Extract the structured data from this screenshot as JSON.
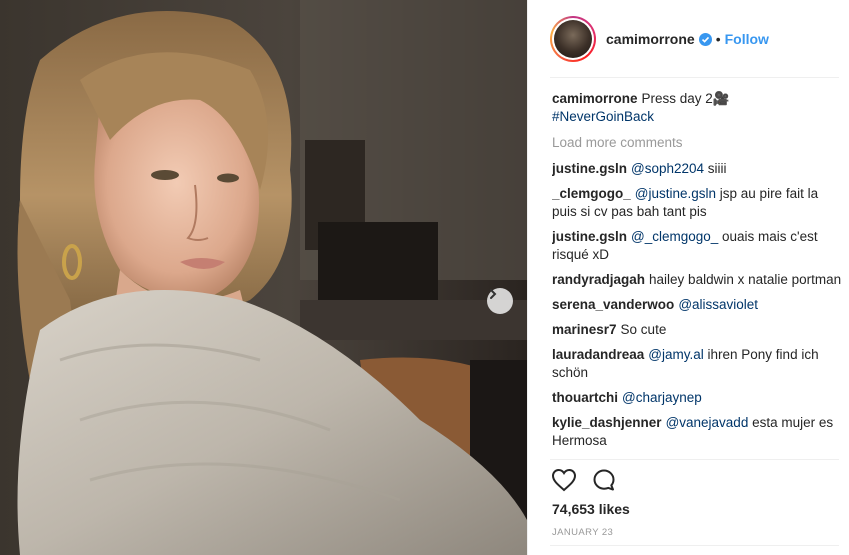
{
  "post": {
    "photo_alt": "camimorrone photo",
    "next_icon": "chevron-right-icon"
  },
  "header": {
    "username": "camimorrone",
    "verified_icon": "verified-badge-icon",
    "separator": "•",
    "follow_label": "Follow"
  },
  "caption": {
    "username": "camimorrone",
    "text": "Press day 2🎥",
    "hashtag": "#NeverGoinBack"
  },
  "load_more_label": "Load more comments",
  "comments": [
    {
      "user": "justine.gsln",
      "mention": "@soph2204",
      "text": " siiii"
    },
    {
      "user": "_clemgogo_",
      "mention": "@justine.gsln",
      "text": " jsp au pire fait la puis si cv pas bah tant pis"
    },
    {
      "user": "justine.gsln",
      "mention": "@_clemgogo_",
      "text": " ouais mais c'est risqué xD"
    },
    {
      "user": "randyradjagah",
      "mention": "",
      "text": "hailey baldwin x natalie portman"
    },
    {
      "user": "serena_vanderwoo",
      "mention": "@alissaviolet",
      "text": ""
    },
    {
      "user": "marinesr7",
      "mention": "",
      "text": "So cute"
    },
    {
      "user": "lauradandreaa",
      "mention": "@jamy.al",
      "text": " ihren Pony find ich schön"
    },
    {
      "user": "thouartchi",
      "mention": "@charjaynep",
      "text": ""
    },
    {
      "user": "kylie_dashjenner",
      "mention": "@vanejavadd",
      "text": " esta mujer es Hermosa"
    }
  ],
  "actions": {
    "like_icon": "heart-icon",
    "comment_icon": "comment-bubble-icon"
  },
  "likes_text": "74,653 likes",
  "date_text": "JANUARY 23",
  "colors": {
    "link": "#003569",
    "follow": "#3897f0",
    "muted": "#999999",
    "text": "#262626"
  }
}
